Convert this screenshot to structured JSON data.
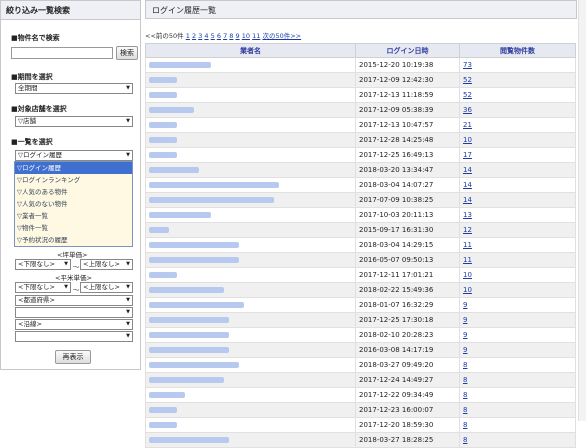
{
  "sidebar": {
    "title": "絞り込み一覧検索",
    "name_section": "■物件名で検索",
    "search_button": "検索",
    "period_section": "■期間を選択",
    "period_value": "全期間",
    "store_section": "■対象店舗を選択",
    "store_value": "▽店舗",
    "list_section": "■一覧を選択",
    "list_value": "▽ログイン履歴",
    "list_options": [
      "▽ログイン履歴",
      "▽ログインランキング",
      "▽人気のある物件",
      "▽人気のない物件",
      "▽業者一覧",
      "▽物件一覧",
      "▽予約状況の履歴"
    ],
    "area_label": "<坪単価>",
    "area_min": "<下限なし>",
    "area_max": "<上限なし>",
    "price_label": "<平米単価>",
    "price_min": "<下限なし>",
    "price_max": "<上限なし>",
    "pref_value": "<都道府県>",
    "line_value": "<沿線>",
    "redisplay_button": "再表示"
  },
  "main": {
    "title": "ログイン履歴一覧",
    "pager_prefix": "<<前の50件",
    "pages": [
      "1",
      "2",
      "3",
      "4",
      "5",
      "6",
      "7",
      "8",
      "9",
      "10",
      "11"
    ],
    "pager_next": "次の50件>>",
    "headers": [
      "業者名",
      "ログイン日時",
      "閲覧物件数"
    ],
    "rows": [
      {
        "d": "2015-12-20 10:19:38",
        "c": "73",
        "w": 62
      },
      {
        "d": "2017-12-09 12:42:30",
        "c": "52",
        "w": 28
      },
      {
        "d": "2017-12-13 11:18:59",
        "c": "52",
        "w": 28
      },
      {
        "d": "2017-12-09 05:38:39",
        "c": "36",
        "w": 45
      },
      {
        "d": "2017-12-13 10:47:57",
        "c": "21",
        "w": 28
      },
      {
        "d": "2017-12-28 14:25:48",
        "c": "10",
        "w": 28
      },
      {
        "d": "2017-12-25 16:49:13",
        "c": "17",
        "w": 28
      },
      {
        "d": "2018-03-20 13:34:47",
        "c": "14",
        "w": 50
      },
      {
        "d": "2018-03-04 14:07:27",
        "c": "14",
        "w": 130
      },
      {
        "d": "2017-07-09 10:38:25",
        "c": "14",
        "w": 125
      },
      {
        "d": "2017-10-03 20:11:13",
        "c": "13",
        "w": 62
      },
      {
        "d": "2015-09-17 16:31:30",
        "c": "12",
        "w": 20
      },
      {
        "d": "2018-03-04 14:29:15",
        "c": "11",
        "w": 90
      },
      {
        "d": "2016-05-07 09:50:13",
        "c": "11",
        "w": 90
      },
      {
        "d": "2017-12-11 17:01:21",
        "c": "10",
        "w": 28
      },
      {
        "d": "2018-02-22 15:49:36",
        "c": "10",
        "w": 75
      },
      {
        "d": "2018-01-07 16:32:29",
        "c": "9",
        "w": 95
      },
      {
        "d": "2017-12-25 17:30:18",
        "c": "9",
        "w": 80
      },
      {
        "d": "2018-02-10 20:28:23",
        "c": "9",
        "w": 80
      },
      {
        "d": "2016-03-08 14:17:19",
        "c": "9",
        "w": 80
      },
      {
        "d": "2018-03-27 09:49:20",
        "c": "8",
        "w": 90
      },
      {
        "d": "2017-12-24 14:49:27",
        "c": "8",
        "w": 75
      },
      {
        "d": "2017-12-22 09:34:49",
        "c": "8",
        "w": 36
      },
      {
        "d": "2017-12-23 16:00:07",
        "c": "8",
        "w": 28
      },
      {
        "d": "2017-12-20 18:59:30",
        "c": "8",
        "w": 28
      },
      {
        "d": "2018-03-27 18:28:25",
        "c": "8",
        "w": 80
      }
    ]
  },
  "colors": {
    "header_bg": "#eef0f5",
    "link": "#1a3ca8",
    "selected": "#3f70d0",
    "blurred": "#b7c9ee"
  }
}
